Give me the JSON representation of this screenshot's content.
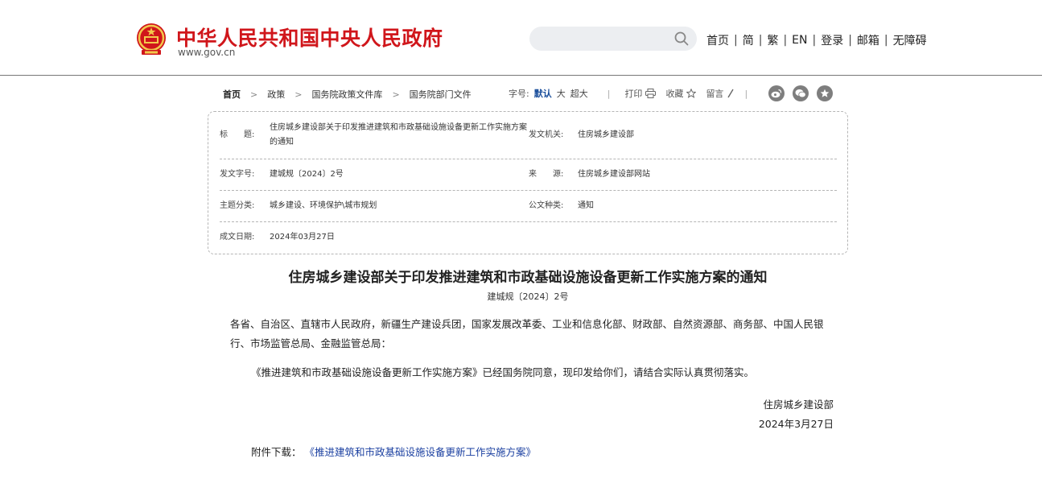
{
  "header": {
    "site_name": "中华人民共和国中央人民政府",
    "site_domain": "www.gov.cn",
    "search": {
      "placeholder": "",
      "value": ""
    },
    "nav": [
      "首页",
      "简",
      "繁",
      "EN",
      "登录",
      "邮箱",
      "无障碍"
    ],
    "nav_separator": "|"
  },
  "breadcrumb": [
    "首页",
    "政策",
    "国务院政策文件库",
    "国务院部门文件"
  ],
  "toolbar": {
    "font_size_label": "字号:",
    "font_sizes": [
      "默认",
      "大",
      "超大"
    ],
    "print": "打印",
    "favorite": "收藏",
    "comment": "留言"
  },
  "info": {
    "title_label": "标　　题:",
    "title_value": "住房城乡建设部关于印发推进建筑和市政基础设施设备更新工作实施方案的通知",
    "issuer_label": "发文机关:",
    "issuer_value": "住房城乡建设部",
    "doc_no_label": "发文字号:",
    "doc_no_value": "建城规〔2024〕2号",
    "source_label": "来　　源:",
    "source_value": "住房城乡建设部网站",
    "topic_label": "主题分类:",
    "topic_value": "城乡建设、环境保护\\城市规划",
    "type_label": "公文种类:",
    "type_value": "通知",
    "date_label": "成文日期:",
    "date_value": "2024年03月27日"
  },
  "article": {
    "title": "住房城乡建设部关于印发推进建筑和市政基础设施设备更新工作实施方案的通知",
    "doc_number": "建城规〔2024〕2号",
    "addressees": "各省、自治区、直辖市人民政府，新疆生产建设兵团，国家发展改革委、工业和信息化部、财政部、自然资源部、商务部、中国人民银行、市场监管总局、金融监管总局：",
    "body": "《推进建筑和市政基础设施设备更新工作实施方案》已经国务院同意，现印发给你们，请结合实际认真贯彻落实。",
    "signature_org": "住房城乡建设部",
    "signature_date": "2024年3月27日",
    "attachment_label": "附件下载：",
    "attachment_link": "《推进建筑和市政基础设施设备更新工作实施方案》"
  },
  "colors": {
    "brand_red": "#d0161b",
    "link_blue": "#1a3fa0",
    "active_blue": "#1a4e9b"
  }
}
